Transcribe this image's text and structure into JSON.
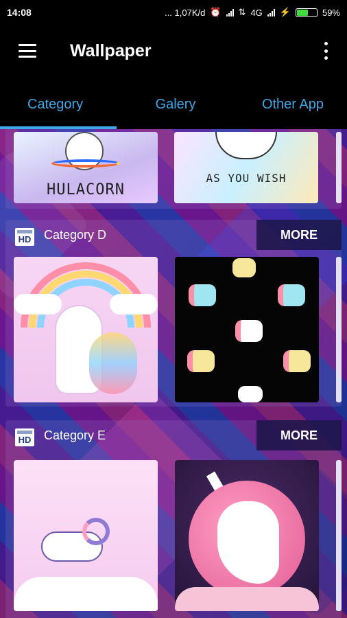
{
  "status_bar": {
    "time": "14:08",
    "data_rate": "... 1,07K/d",
    "network": "4G",
    "battery": "59%",
    "battery_fill": 0.59
  },
  "app_bar": {
    "title": "Wallpaper"
  },
  "tabs": [
    {
      "label": "Category"
    },
    {
      "label": "Galery"
    },
    {
      "label": "Other App"
    }
  ],
  "sections": [
    {
      "title": "",
      "thumbs": [
        {
          "caption": "HULACORN"
        },
        {
          "caption": "AS YOU WISH"
        }
      ]
    },
    {
      "badge": "HD",
      "title": "Category D",
      "more": "MORE"
    },
    {
      "badge": "HD",
      "title": "Category E",
      "more": "MORE"
    }
  ],
  "colors": {
    "accent": "#3ea8e8",
    "app_bar_bg": "#000000",
    "battery_green": "#3fdc3f"
  }
}
